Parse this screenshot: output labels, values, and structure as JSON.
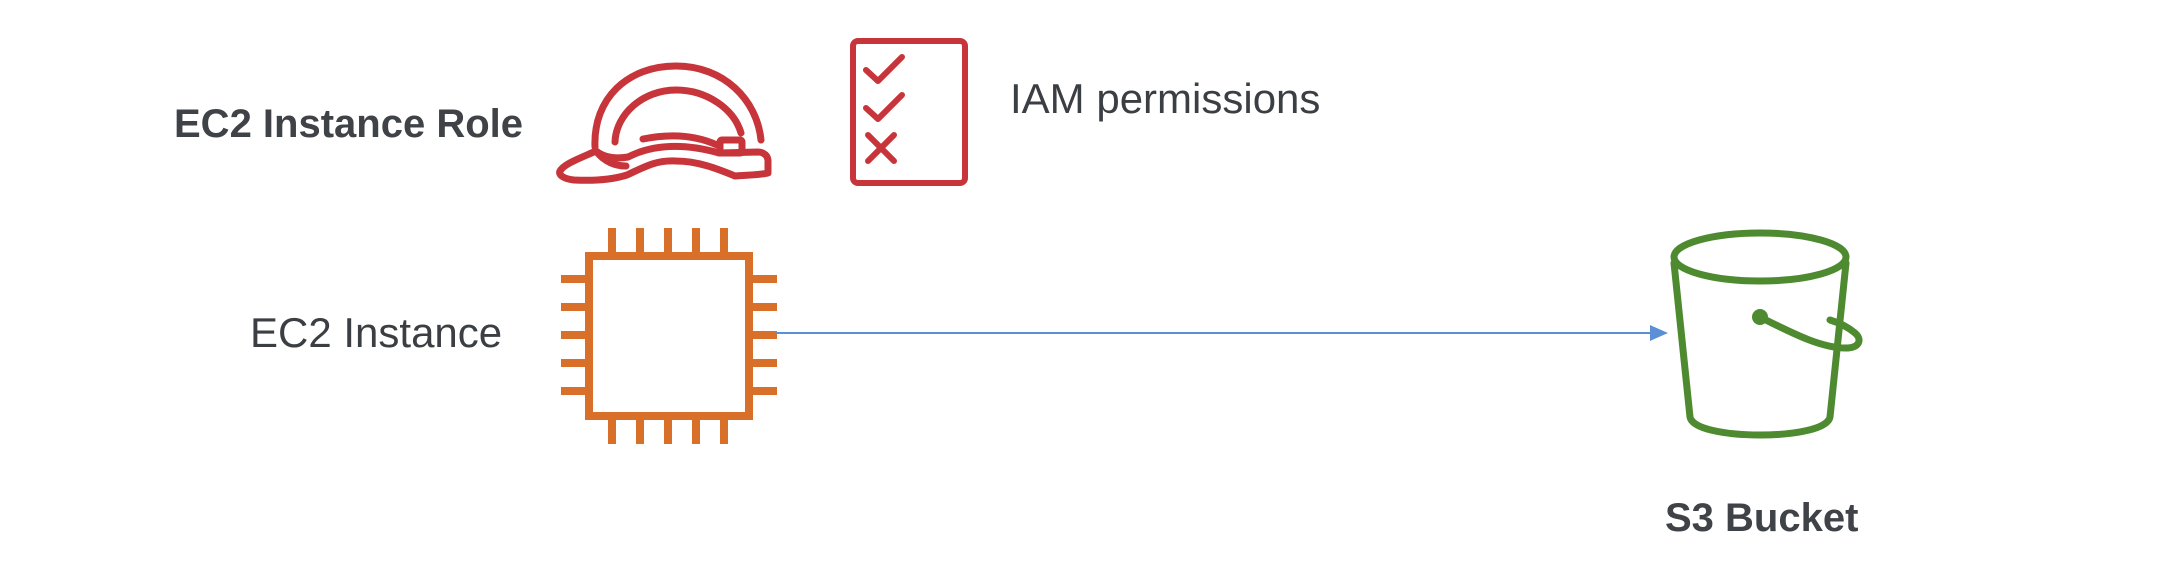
{
  "labels": {
    "role": "EC2 Instance Role",
    "permissions": "IAM permissions",
    "instance": "EC2 Instance",
    "bucket": "S3 Bucket"
  },
  "icons": {
    "role": "hard-hat-icon",
    "permissions": "checklist-icon",
    "instance": "chip-icon",
    "bucket": "bucket-icon"
  },
  "colors": {
    "role_icon": "#c7353b",
    "permissions_icon": "#c7353b",
    "instance_icon": "#d9702a",
    "bucket_icon": "#4e8a2f",
    "arrow": "#5b8fd6",
    "text": "#3b3f44"
  }
}
